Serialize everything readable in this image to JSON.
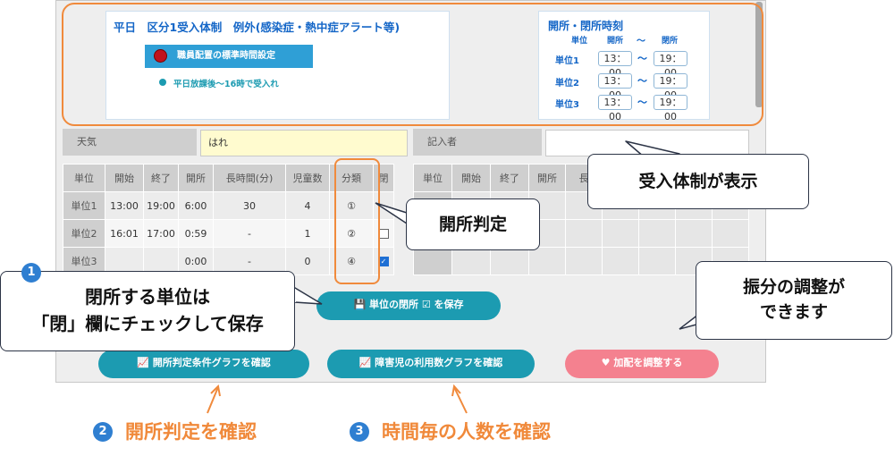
{
  "header": {
    "title": "平日　区分1受入体制　例外(感染症・熱中症アラート等)",
    "staffing_button": "職員配置の標準時間設定",
    "bullet_item": "平日放課後～16時で受入れ"
  },
  "hours": {
    "title": "開所・閉所時刻",
    "col_unit": "単位",
    "col_open": "開所",
    "col_tilde": "～",
    "col_close": "閉所",
    "rows": [
      {
        "unit": "単位1",
        "open": "13：00",
        "close": "19：00"
      },
      {
        "unit": "単位2",
        "open": "13：00",
        "close": "19：00"
      },
      {
        "unit": "単位3",
        "open": "13：00",
        "close": "19：00"
      }
    ]
  },
  "weather": {
    "label": "天気",
    "value": "はれ"
  },
  "recorder": {
    "label": "記入者"
  },
  "table": {
    "headers": [
      "単位",
      "開始",
      "終了",
      "開所",
      "長時間(分)",
      "児童数",
      "分類",
      "閉"
    ],
    "rows": [
      {
        "unit": "単位1",
        "start": "13:00",
        "end": "19:00",
        "open": "6:00",
        "long": "30",
        "children": "4",
        "category": "①"
      },
      {
        "unit": "単位2",
        "start": "16:01",
        "end": "17:00",
        "open": "0:59",
        "long": "-",
        "children": "1",
        "category": "②"
      },
      {
        "unit": "単位3",
        "start": "",
        "end": "",
        "open": "0:00",
        "long": "-",
        "children": "0",
        "category": "④"
      }
    ],
    "checks": [
      false,
      false,
      true
    ]
  },
  "right_table": {
    "headers": [
      "単位",
      "開始",
      "終了",
      "開所",
      "長"
    ]
  },
  "buttons": {
    "save_closure": "単位の閉所 ☑ を保存",
    "criteria_graph": "開所判定条件グラフを確認",
    "usage_graph": "障害児の利用数グラフを確認",
    "adjust": "加配を調整する"
  },
  "callouts": {
    "system_shown": "受入体制が表示",
    "opening_judgment": "開所判定",
    "close_line1": "閉所する単位は",
    "close_line2": "「閉」欄にチェックして保存",
    "alloc_line1": "振分の調整が",
    "alloc_line2": "できます"
  },
  "steps": [
    {
      "num": "1"
    },
    {
      "num": "2",
      "text": "開所判定を確認"
    },
    {
      "num": "3",
      "text": "時間毎の人数を確認"
    }
  ]
}
